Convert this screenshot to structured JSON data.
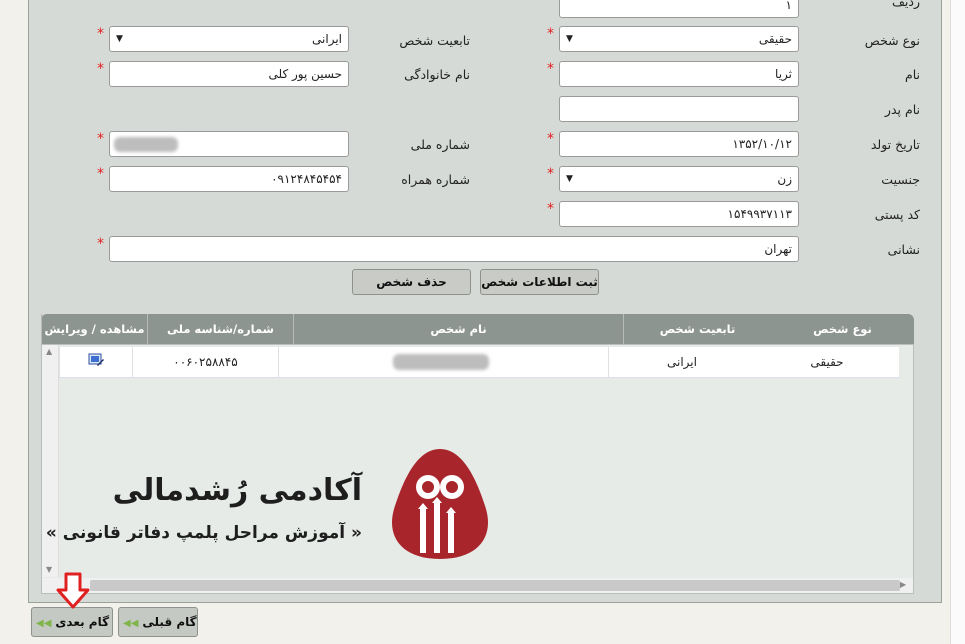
{
  "form": {
    "radif_label": "ردیف",
    "radif_value": "۱",
    "person_type_label": "نوع شخص",
    "person_type_value": "حقیقی",
    "nationality_label": "تابعیت شخص",
    "nationality_value": "ایرانی",
    "first_name_label": "نام",
    "first_name_value": "ثریا",
    "last_name_label": "نام خانوادگی",
    "last_name_value": "حسین پور کلی",
    "father_name_label": "نام پدر",
    "father_name_value": "",
    "birth_date_label": "تاریخ تولد",
    "birth_date_value": "۱۳۵۲/۱۰/۱۲",
    "national_id_label": "شماره ملی",
    "gender_label": "جنسیت",
    "gender_value": "زن",
    "mobile_label": "شماره همراه",
    "mobile_value": "۰۹۱۲۴۸۴۵۴۵۴",
    "postal_code_label": "کد پستی",
    "postal_code_value": "۱۵۴۹۹۳۷۱۱۳",
    "address_label": "نشانی",
    "address_value": "تهران",
    "required_mark": "*",
    "save_button": "ثبت اطلاعات شخص",
    "delete_button": "حذف شخص"
  },
  "grid": {
    "columns": [
      "نوع شخص",
      "تابعیت شخص",
      "نام شخص",
      "شماره/شناسه ملی",
      "مشاهده / ویرایش"
    ],
    "rows": [
      {
        "person_type": "حقیقی",
        "nationality": "ایرانی",
        "national_id": "۰۰۶۰۲۵۸۸۴۵"
      }
    ]
  },
  "watermark": {
    "title": "آکادمی رُشدمالی",
    "subtitle": "« آموزش مراحل پلمپ دفاتر قانونی »",
    "brand_color": "#a8262b"
  },
  "nav": {
    "next": "گام بعدی",
    "prev": "گام قبلی",
    "arrow_color": "#e02020"
  }
}
